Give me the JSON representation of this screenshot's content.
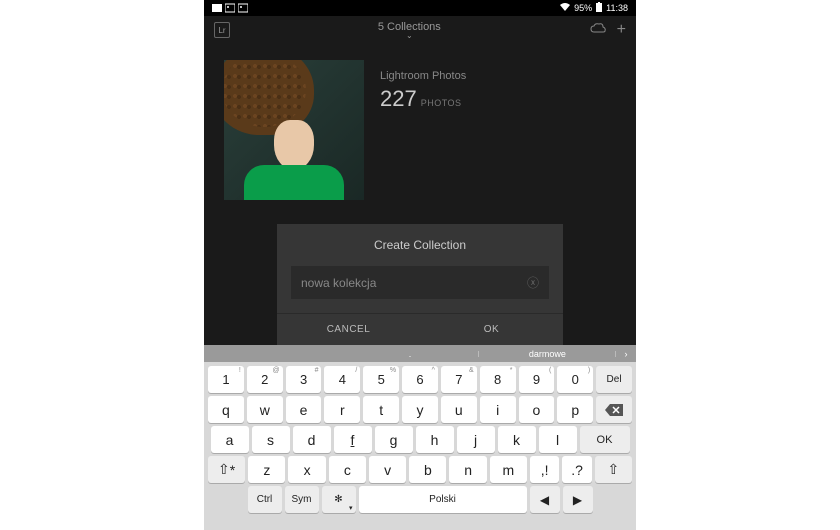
{
  "status_bar": {
    "wifi_percent": "95%",
    "time": "11:38"
  },
  "header": {
    "title": "5 Collections",
    "logo_text": "Lr"
  },
  "collection": {
    "label": "Lightroom Photos",
    "count": "227",
    "count_label": "PHOTOS"
  },
  "dialog": {
    "title": "Create Collection",
    "input_value": "nowa kolekcja",
    "cancel": "CANCEL",
    "ok": "OK"
  },
  "keyboard": {
    "suggestions": [
      "",
      ".",
      "darmowe"
    ],
    "row1": [
      {
        "k": "1",
        "s": "!"
      },
      {
        "k": "2",
        "s": "@"
      },
      {
        "k": "3",
        "s": "#"
      },
      {
        "k": "4",
        "s": "/"
      },
      {
        "k": "5",
        "s": "%"
      },
      {
        "k": "6",
        "s": "^"
      },
      {
        "k": "7",
        "s": "&"
      },
      {
        "k": "8",
        "s": "*"
      },
      {
        "k": "9",
        "s": "("
      },
      {
        "k": "0",
        "s": ")"
      }
    ],
    "row2": [
      {
        "k": "q"
      },
      {
        "k": "w"
      },
      {
        "k": "e"
      },
      {
        "k": "r"
      },
      {
        "k": "t"
      },
      {
        "k": "y"
      },
      {
        "k": "u"
      },
      {
        "k": "i"
      },
      {
        "k": "o"
      },
      {
        "k": "p"
      }
    ],
    "row3": [
      {
        "k": "a"
      },
      {
        "k": "s"
      },
      {
        "k": "d"
      },
      {
        "k": "f",
        "u": true
      },
      {
        "k": "g"
      },
      {
        "k": "h"
      },
      {
        "k": "j",
        "u": true
      },
      {
        "k": "k"
      },
      {
        "k": "l"
      }
    ],
    "row4": [
      {
        "k": "z"
      },
      {
        "k": "x"
      },
      {
        "k": "c"
      },
      {
        "k": "v"
      },
      {
        "k": "b"
      },
      {
        "k": "n"
      },
      {
        "k": "m"
      }
    ],
    "del": "Del",
    "ok": "OK",
    "ctrl": "Ctrl",
    "sym": "Sym",
    "space": "Polski",
    "comma": ",",
    "period": ".",
    "excl": "!",
    "quest": "?",
    "shift_sup": "*"
  }
}
